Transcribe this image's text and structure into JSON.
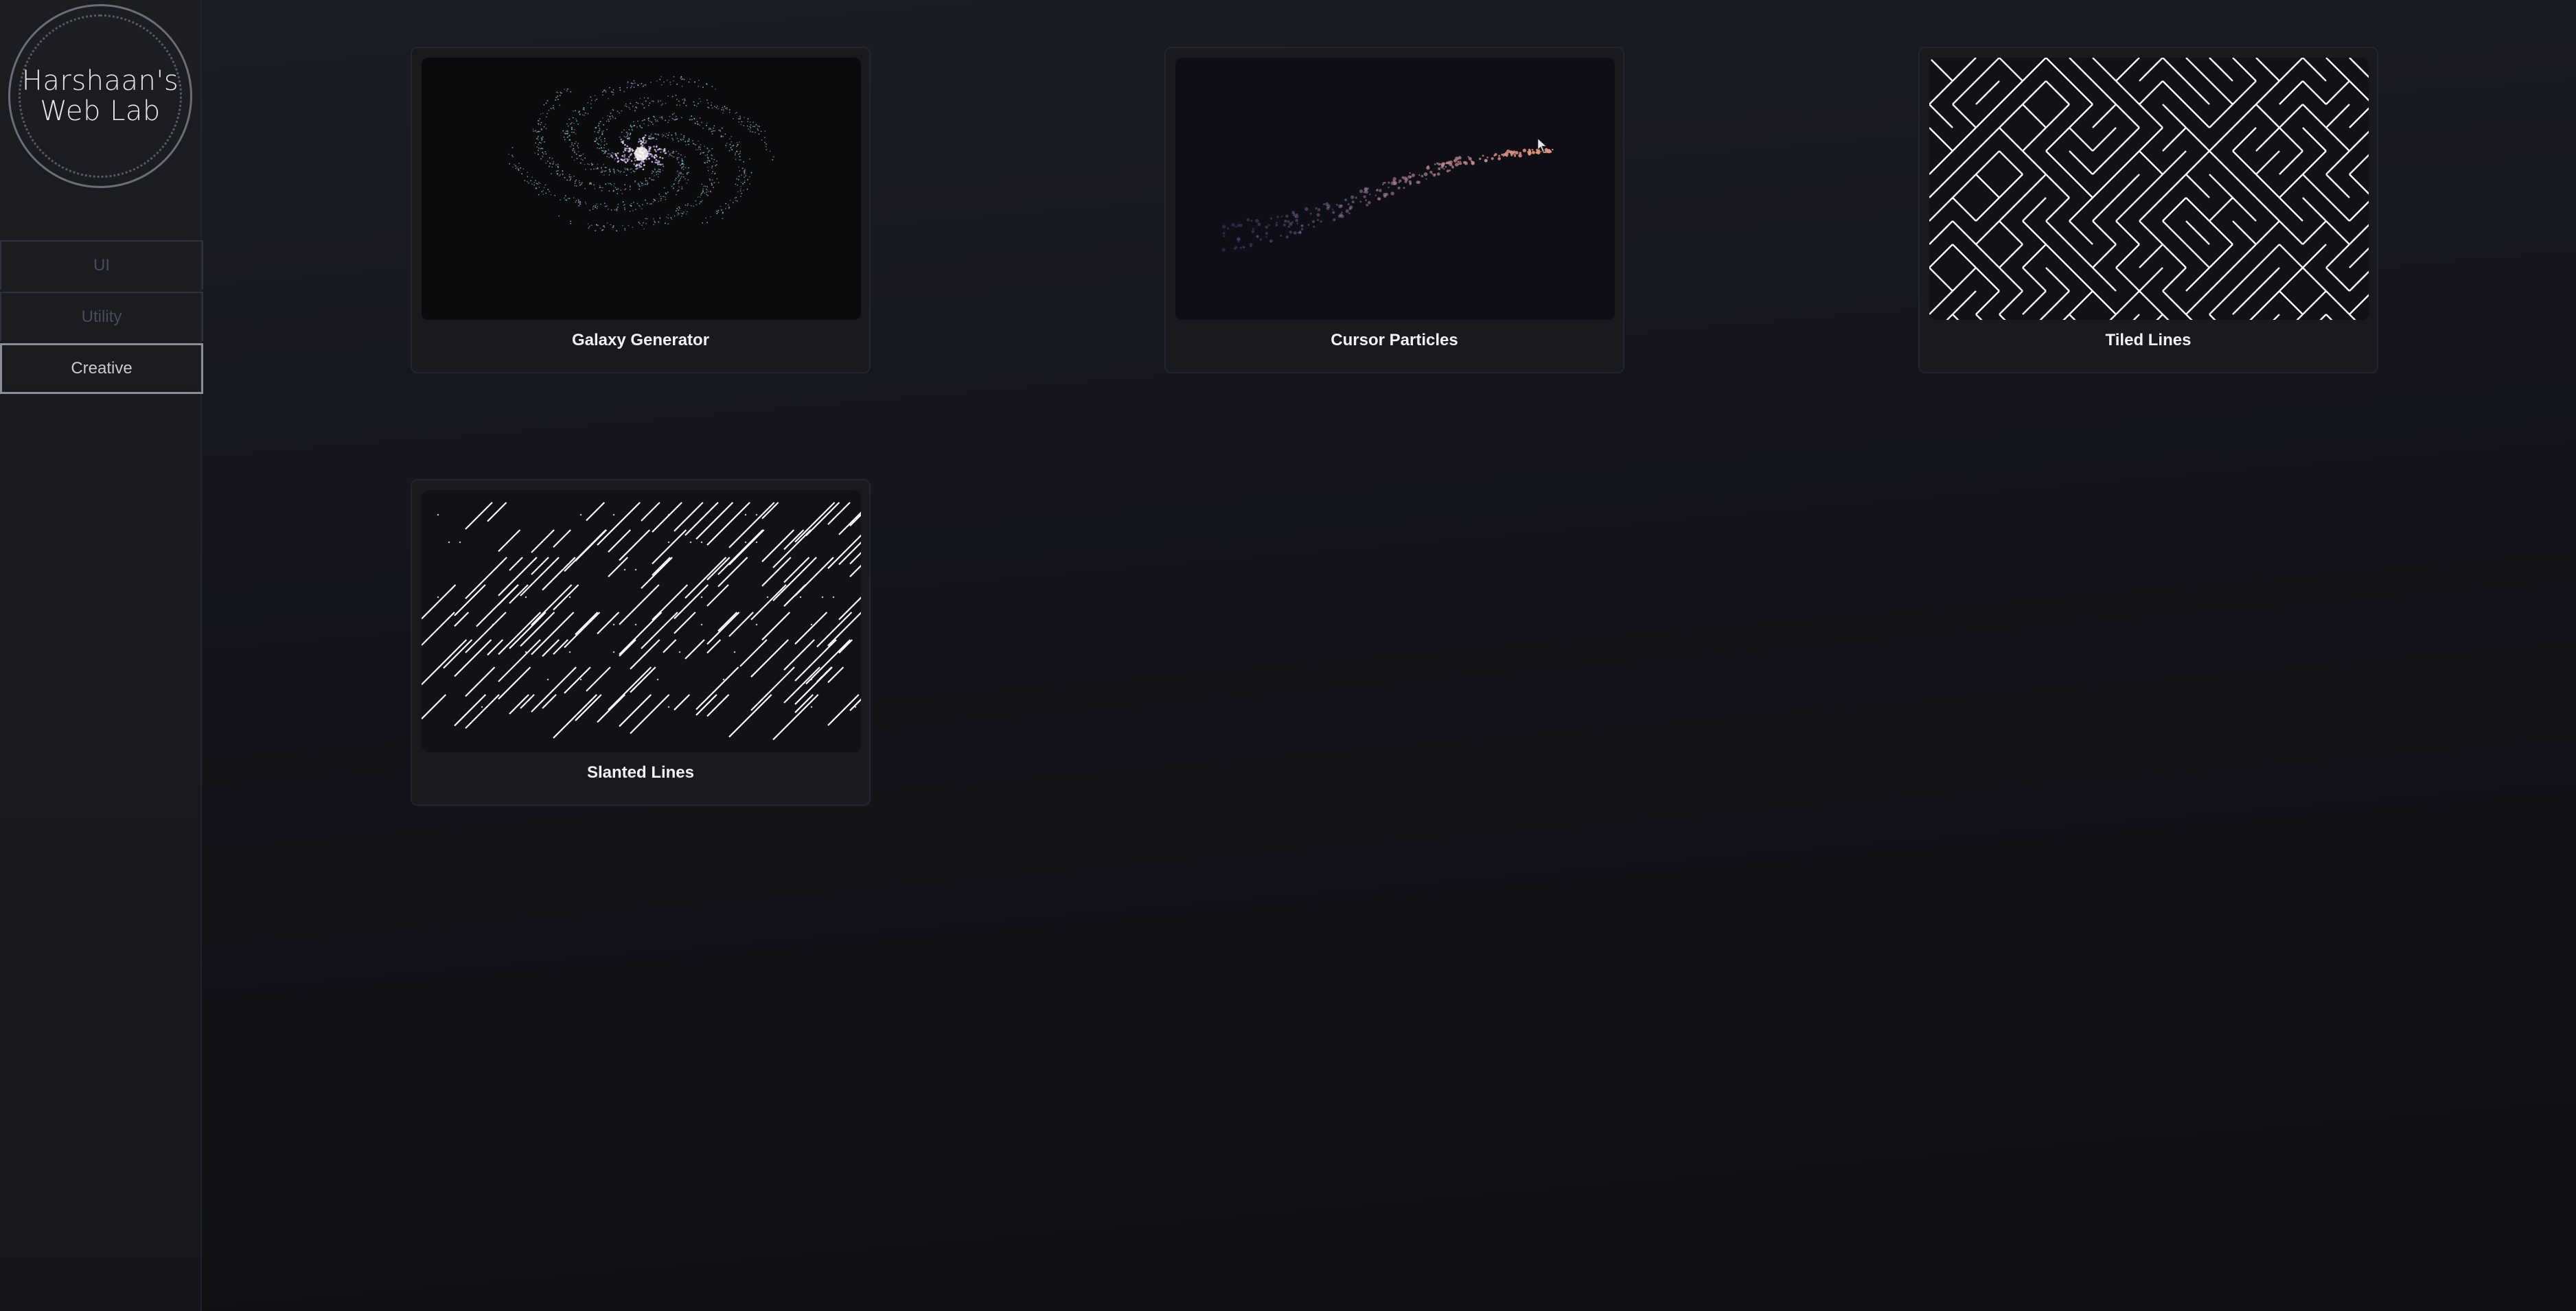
{
  "sidebar": {
    "logo_line1": "Harshaan's",
    "logo_line2": "Web Lab",
    "nav": [
      {
        "label": "UI"
      },
      {
        "label": "Utility"
      },
      {
        "label": "Creative"
      }
    ],
    "active": "Creative"
  },
  "projects": [
    {
      "title": "Galaxy Generator",
      "thumbnail": "galaxy-spiral"
    },
    {
      "title": "Cursor Particles",
      "thumbnail": "particle-trail"
    },
    {
      "title": "Tiled Lines",
      "thumbnail": "maze-tiles"
    },
    {
      "title": "Slanted Lines",
      "thumbnail": "diagonal-lines"
    }
  ],
  "colors": {
    "background": "#15161c",
    "card": "#191a20",
    "accent_border": "#8b8e95"
  }
}
